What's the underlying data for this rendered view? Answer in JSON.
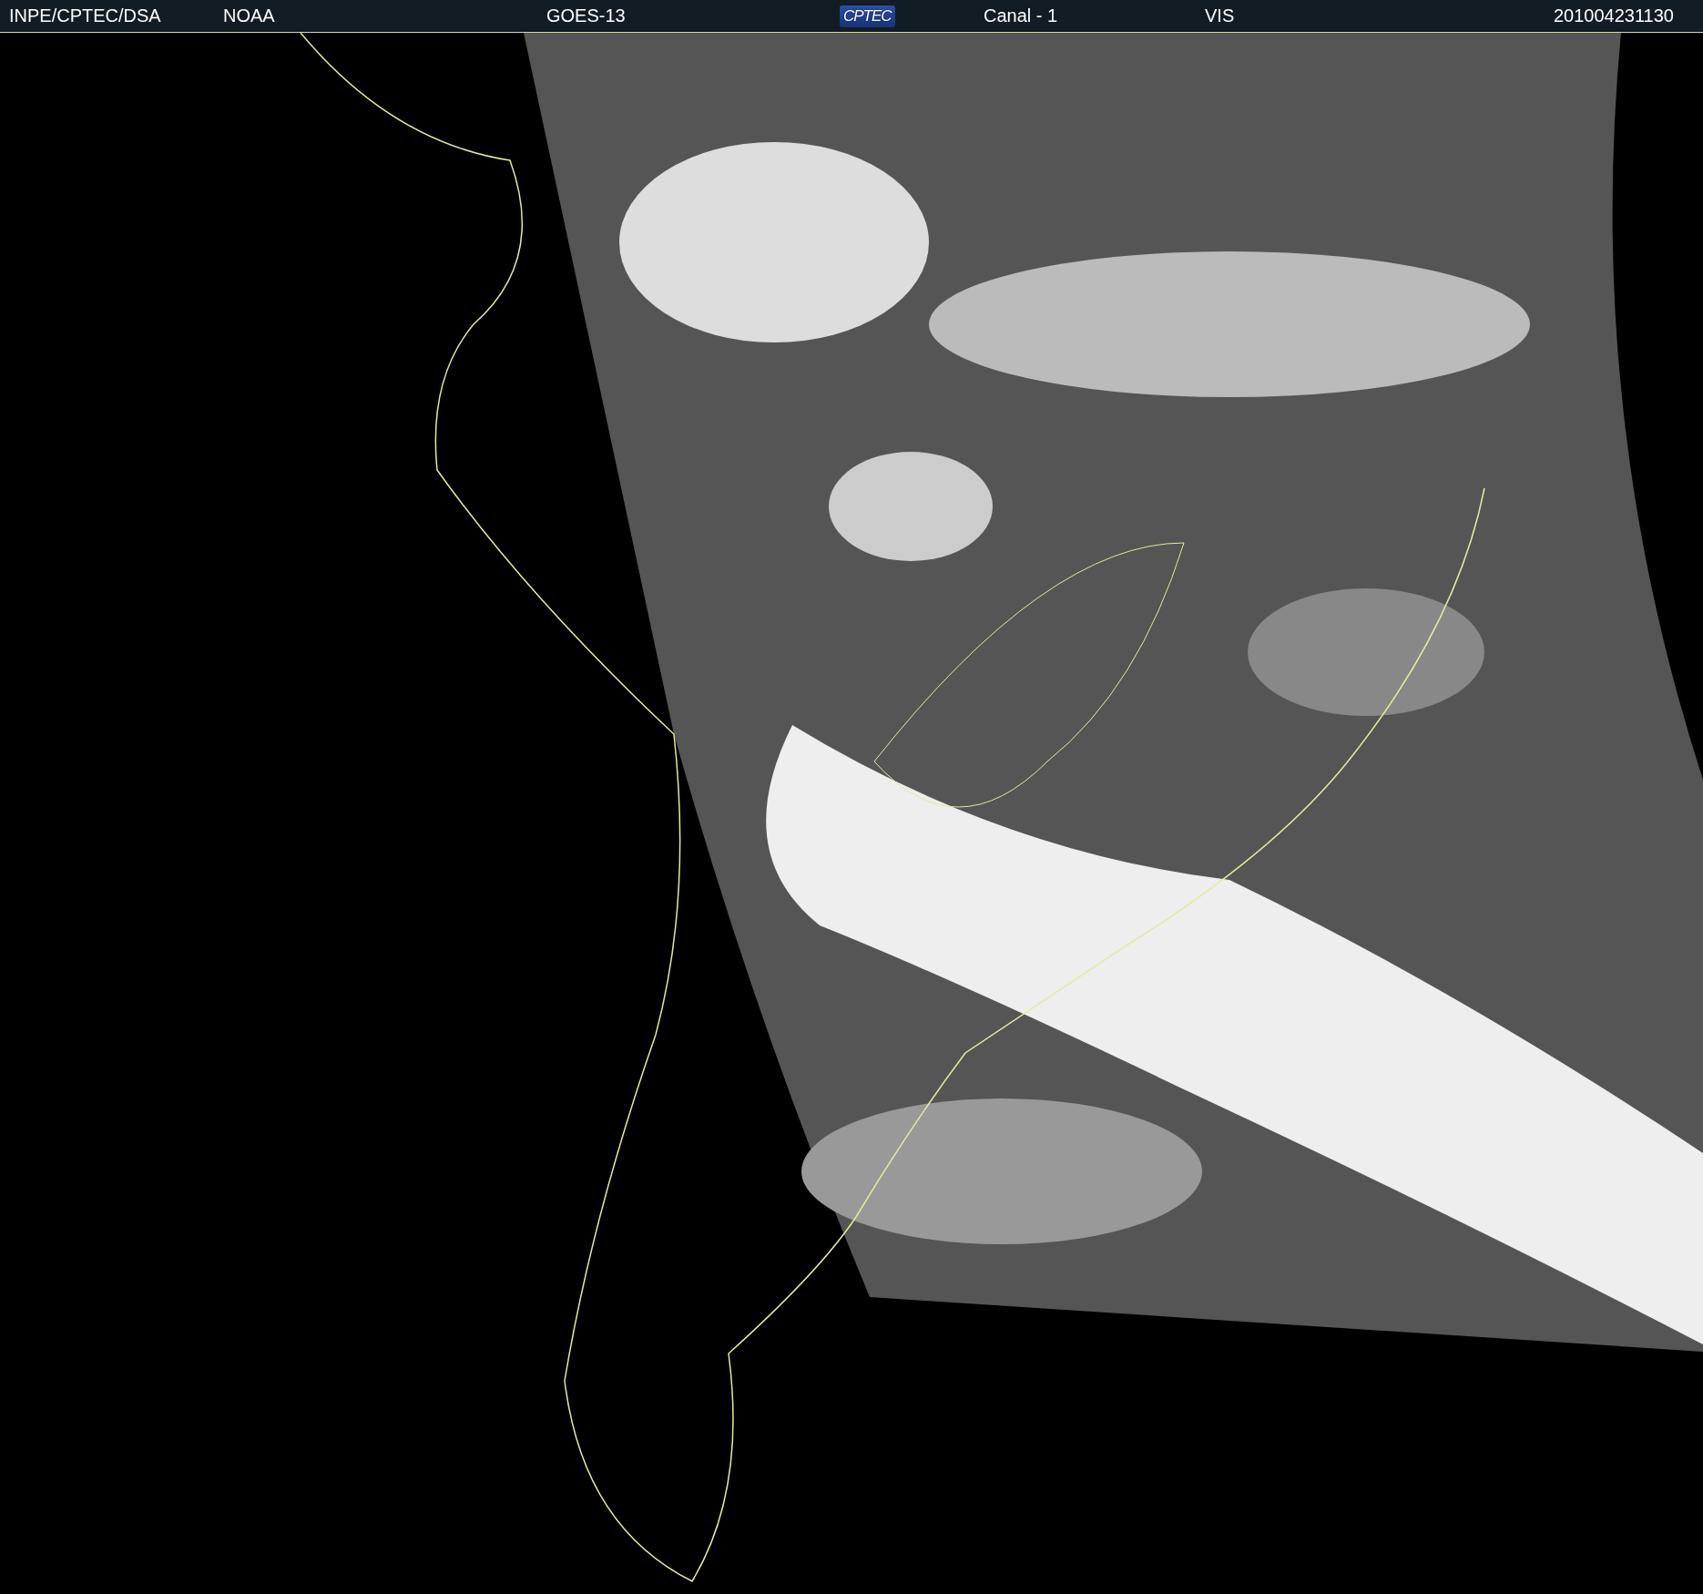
{
  "header": {
    "items": [
      {
        "kind": "text",
        "text": "INPE/CPTEC/DSA"
      },
      {
        "kind": "text",
        "text": "NOAA"
      },
      {
        "kind": "text",
        "text": "GOES-13"
      },
      {
        "kind": "logo",
        "text": "CPTEC"
      },
      {
        "kind": "text",
        "text": "Canal - 1"
      },
      {
        "kind": "text",
        "text": "VIS"
      },
      {
        "kind": "text",
        "text": "201004231130"
      }
    ]
  }
}
